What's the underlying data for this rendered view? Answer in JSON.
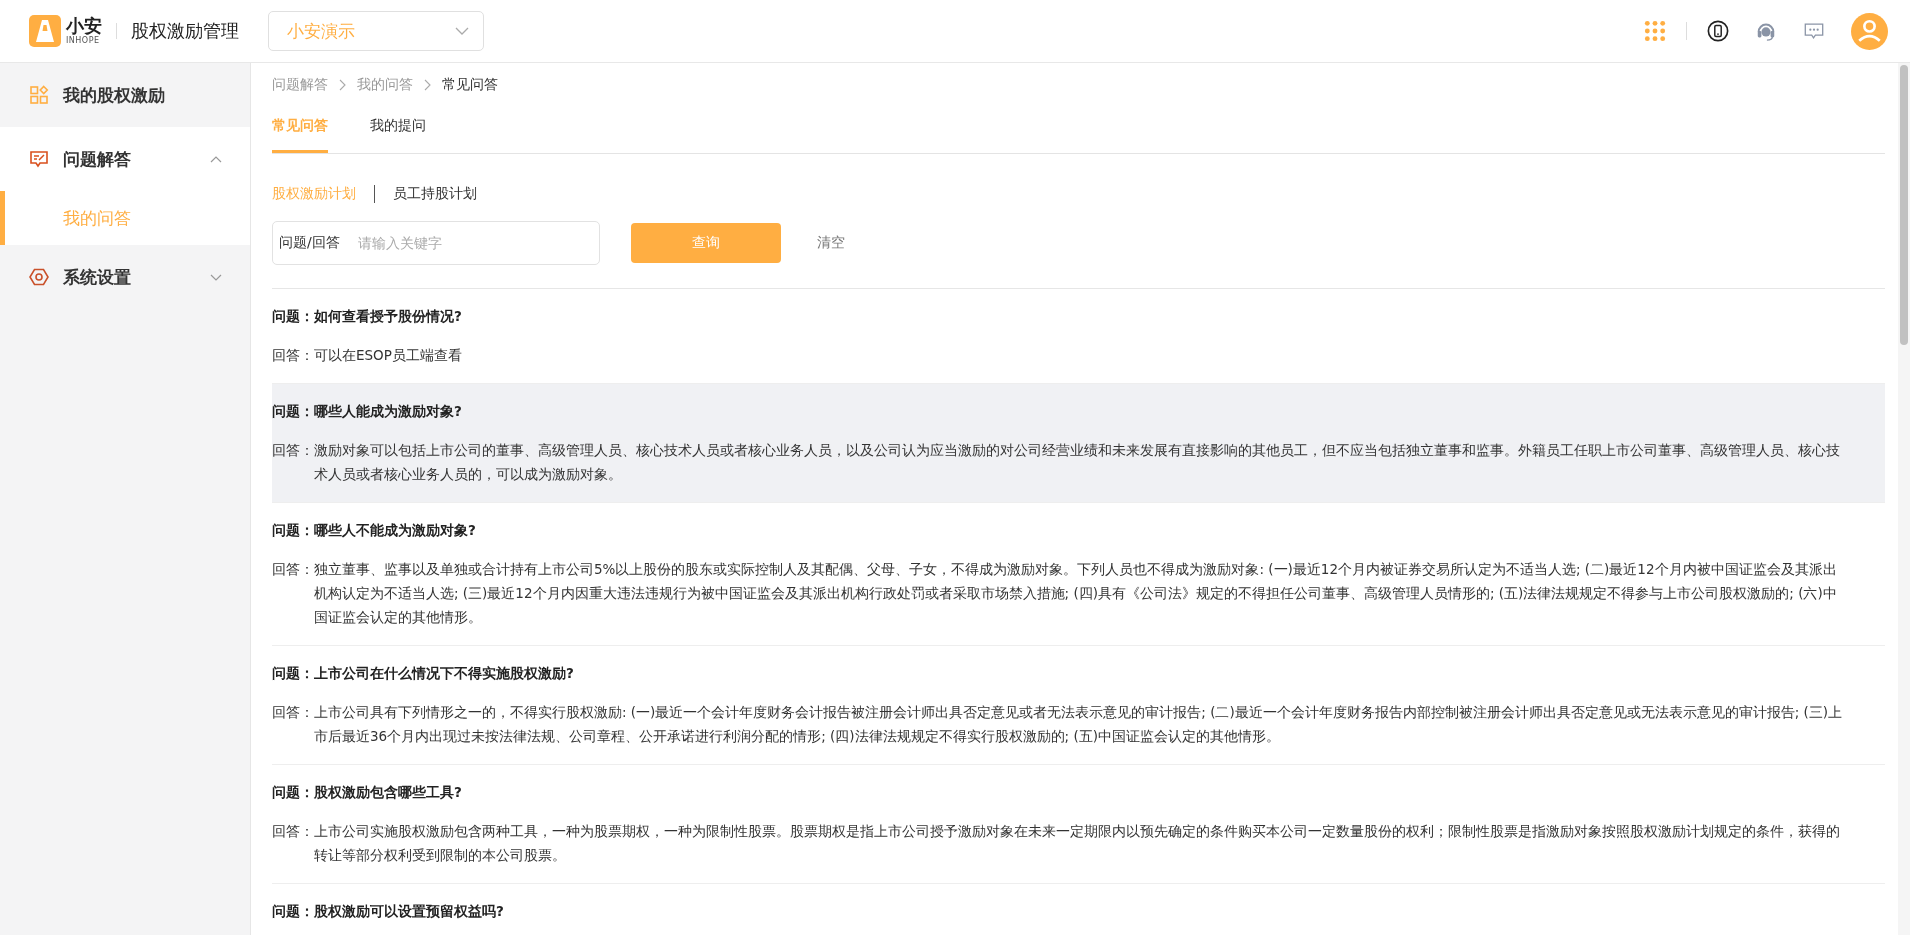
{
  "header": {
    "logo_text": "小安",
    "logo_subtext": "INHOPE",
    "app_title": "股权激励管理",
    "company_select": "小安演示"
  },
  "sidebar": {
    "items": [
      {
        "kind": "link",
        "label": "我的股权激励"
      },
      {
        "kind": "group",
        "label": "问题解答",
        "expanded": true,
        "children": [
          {
            "label": "我的问答",
            "selected": true
          }
        ]
      },
      {
        "kind": "group",
        "label": "系统设置",
        "expanded": false
      }
    ]
  },
  "breadcrumb": [
    "问题解答",
    "我的问答",
    "常见问答"
  ],
  "tabs": [
    {
      "label": "常见问答",
      "selected": true
    },
    {
      "label": "我的提问",
      "selected": false
    }
  ],
  "plan_tabs": [
    {
      "label": "股权激励计划",
      "selected": true
    },
    {
      "label": "员工持股计划",
      "selected": false
    }
  ],
  "search": {
    "label": "问题/回答",
    "placeholder": "请输入关键字",
    "query_button": "查询",
    "clear_button": "清空"
  },
  "faq": [
    {
      "question_label": "问题：",
      "question": "如何查看授予股份情况?",
      "answer_label": "回答：",
      "answer": "可以在ESOP员工端查看",
      "highlighted": false
    },
    {
      "question_label": "问题：",
      "question": "哪些人能成为激励对象?",
      "answer_label": "回答：",
      "answer": "激励对象可以包括上市公司的董事、高级管理人员、核心技术人员或者核心业务人员，以及公司认为应当激励的对公司经营业绩和未来发展有直接影响的其他员工，但不应当包括独立董事和监事。外籍员工任职上市公司董事、高级管理人员、核心技术人员或者核心业务人员的，可以成为激励对象。",
      "highlighted": true
    },
    {
      "question_label": "问题：",
      "question": "哪些人不能成为激励对象?",
      "answer_label": "回答：",
      "answer": "独立董事、监事以及单独或合计持有上市公司5%以上股份的股东或实际控制人及其配偶、父母、子女，不得成为激励对象。下列人员也不得成为激励对象: (一)最近12个月内被证券交易所认定为不适当人选; (二)最近12个月内被中国证监会及其派出机构认定为不适当人选; (三)最近12个月内因重大违法违规行为被中国证监会及其派出机构行政处罚或者采取市场禁入措施; (四)具有《公司法》规定的不得担任公司董事、高级管理人员情形的; (五)法律法规规定不得参与上市公司股权激励的; (六)中国证监会认定的其他情形。",
      "highlighted": false
    },
    {
      "question_label": "问题：",
      "question": "上市公司在什么情况下不得实施股权激励?",
      "answer_label": "回答：",
      "answer": "上市公司具有下列情形之一的，不得实行股权激励: (一)最近一个会计年度财务会计报告被注册会计师出具否定意见或者无法表示意见的审计报告; (二)最近一个会计年度财务报告内部控制被注册会计师出具否定意见或无法表示意见的审计报告; (三)上市后最近36个月内出现过未按法律法规、公司章程、公开承诺进行利润分配的情形; (四)法律法规规定不得实行股权激励的; (五)中国证监会认定的其他情形。",
      "highlighted": false
    },
    {
      "question_label": "问题：",
      "question": "股权激励包含哪些工具?",
      "answer_label": "回答：",
      "answer": "上市公司实施股权激励包含两种工具，一种为股票期权，一种为限制性股票。股票期权是指上市公司授予激励对象在未来一定期限内以预先确定的条件购买本公司一定数量股份的权利；限制性股票是指激励对象按照股权激励计划规定的条件，获得的转让等部分权利受到限制的本公司股票。",
      "highlighted": false
    },
    {
      "question_label": "问题：",
      "question": "股权激励可以设置预留权益吗?",
      "highlighted": false
    }
  ]
}
